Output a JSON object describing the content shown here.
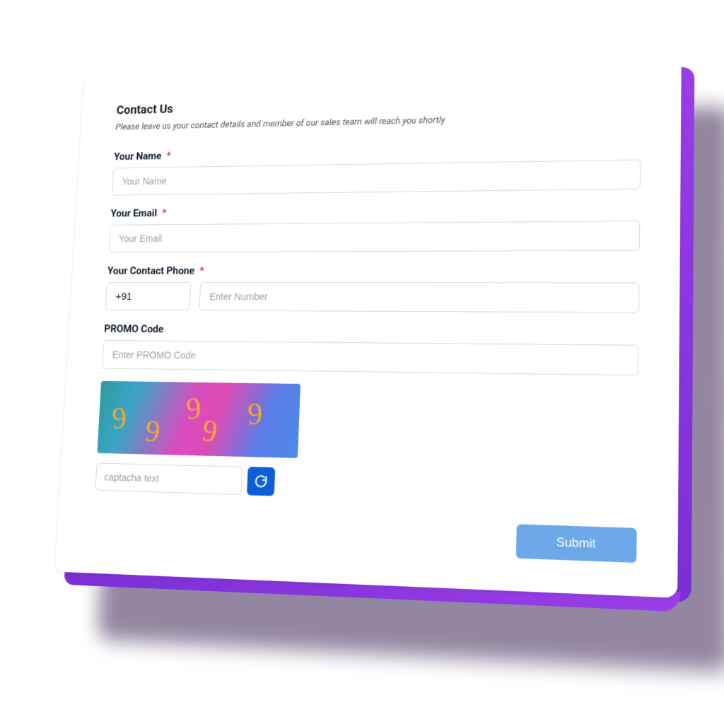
{
  "header": {
    "title": "Contact Us",
    "subtitle": "Please leave us your contact details and member of our sales team will reach you shortly"
  },
  "fields": {
    "name": {
      "label": "Your Name",
      "placeholder": "Your Name",
      "required": "*"
    },
    "email": {
      "label": "Your Email",
      "placeholder": "Your Email",
      "required": "*"
    },
    "phone": {
      "label": "Your Contact Phone",
      "required": "*",
      "code_value": "+91",
      "placeholder": "Enter Number"
    },
    "promo": {
      "label": "PROMO Code",
      "placeholder": "Enter PROMO Code"
    }
  },
  "captcha": {
    "digits": [
      "9",
      "9",
      "9",
      "9",
      "9"
    ],
    "input_placeholder": "captacha text"
  },
  "actions": {
    "submit": "Submit"
  }
}
